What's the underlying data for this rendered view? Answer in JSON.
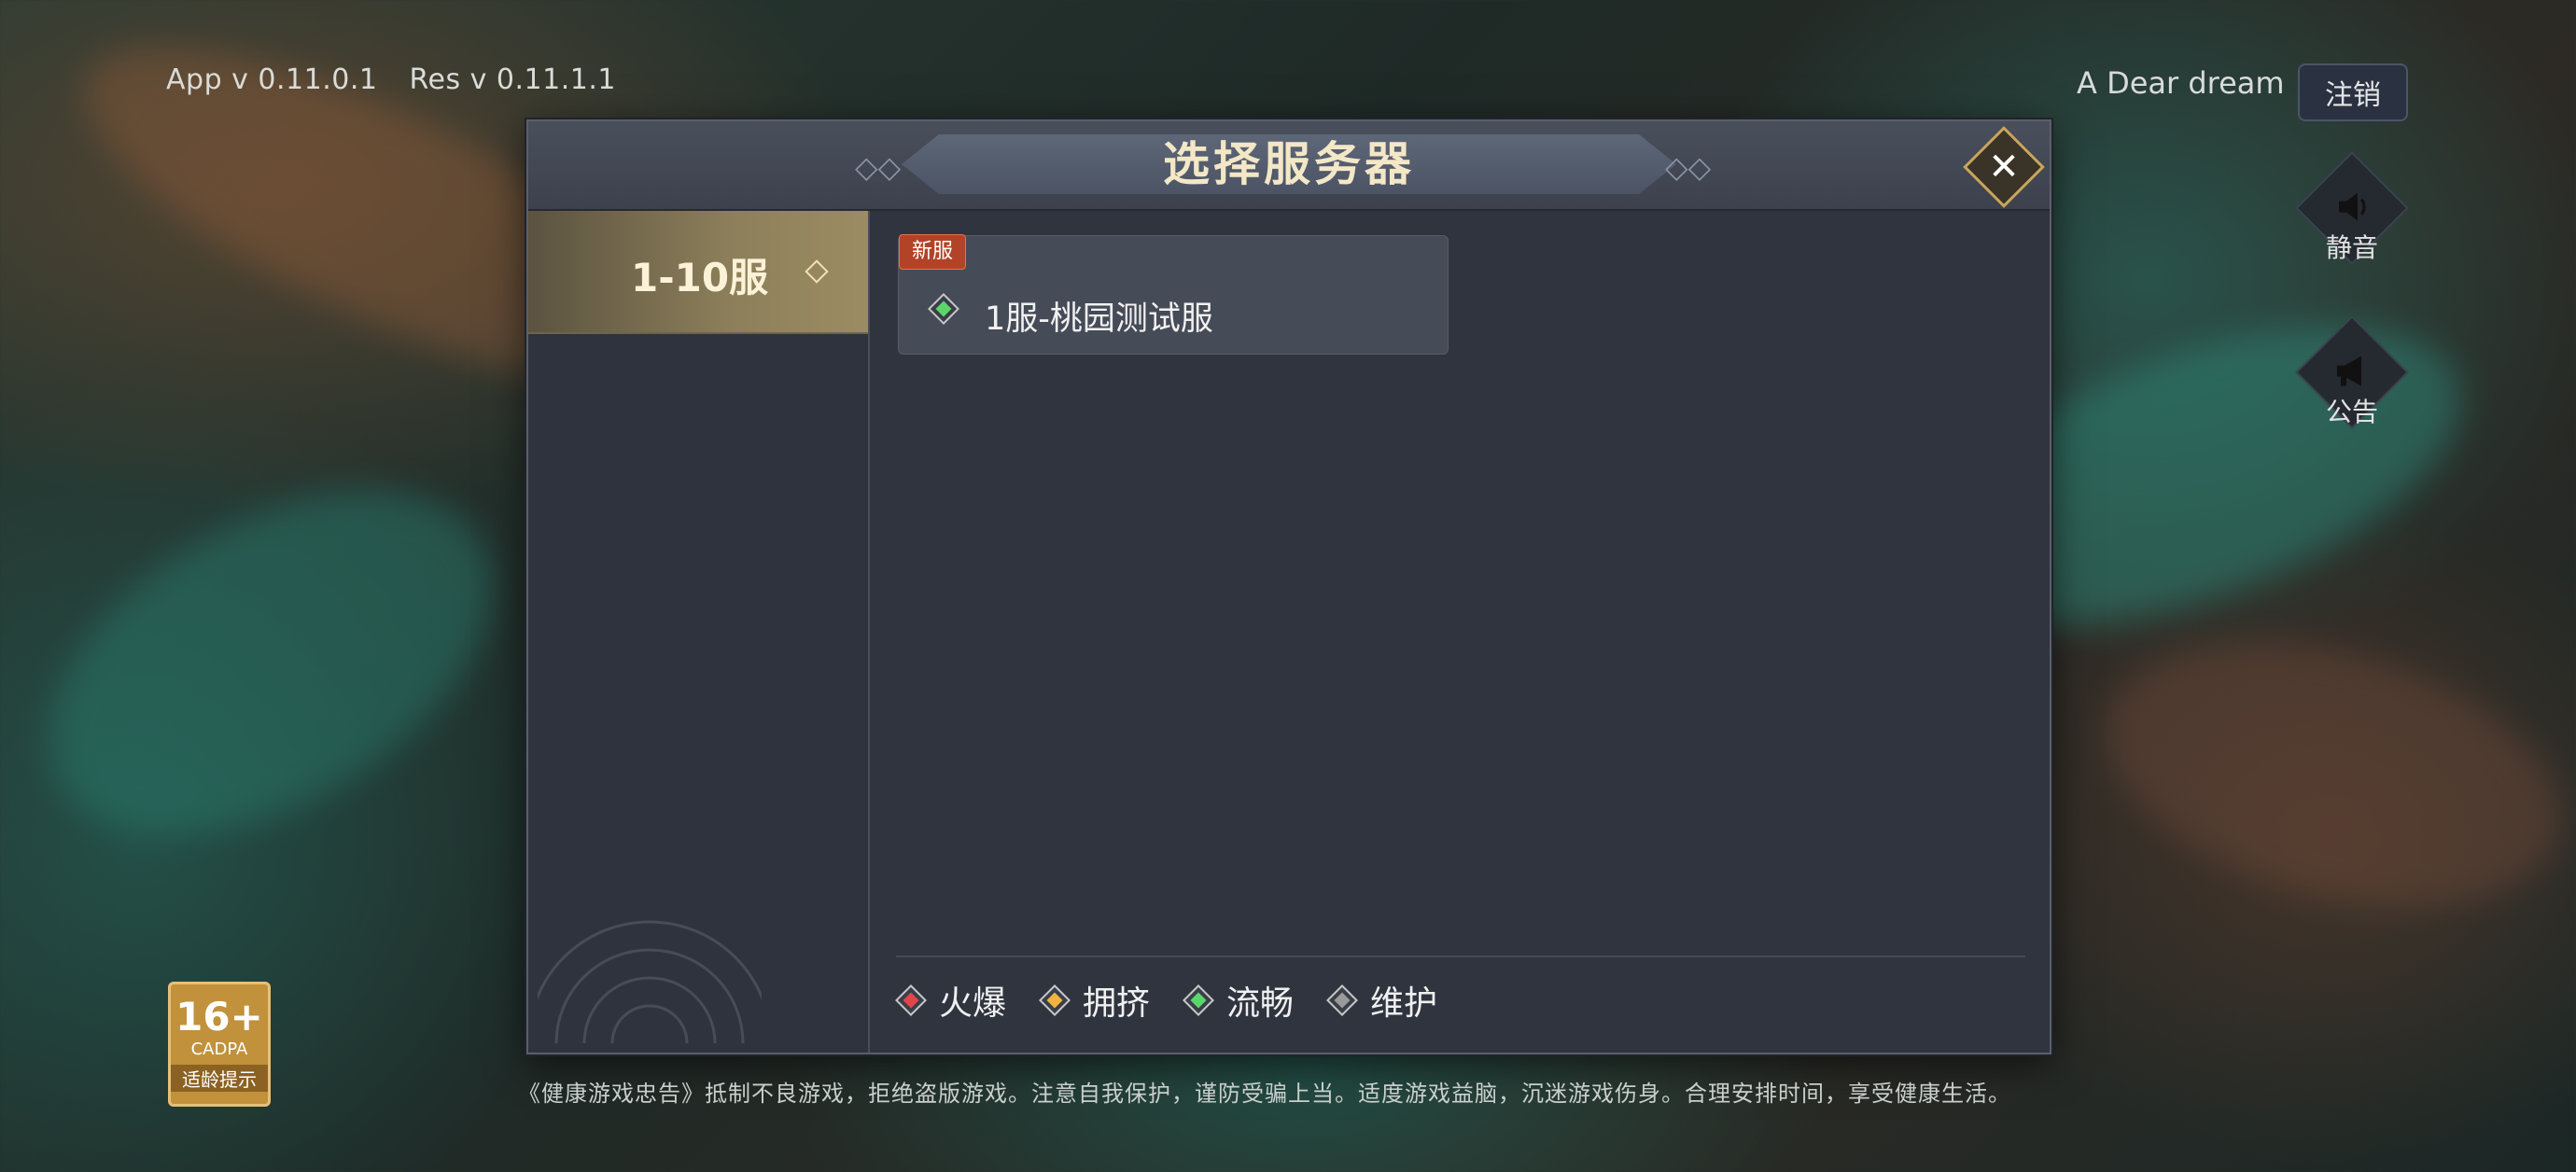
{
  "version": {
    "app": "App v 0.11.0.1",
    "res": "Res v 0.11.1.1"
  },
  "account": {
    "username": "A Dear dream",
    "logout_label": "注销"
  },
  "side_buttons": {
    "mute_label": "静音",
    "notice_label": "公告"
  },
  "dialog": {
    "title": "选择服务器",
    "range_tab": {
      "label": "1-10服"
    },
    "servers": [
      {
        "badge": "新服",
        "name": "1服-桃园测试服",
        "status": "流畅"
      }
    ],
    "legend": [
      {
        "label": "火爆",
        "color": "#e0454a"
      },
      {
        "label": "拥挤",
        "color": "#f1b43e"
      },
      {
        "label": "流畅",
        "color": "#5bd76a"
      },
      {
        "label": "维护",
        "color": "#9a9a9a"
      }
    ]
  },
  "age_rating": {
    "rating": "16+",
    "org": "CADPA",
    "tip": "适龄提示"
  },
  "footer": {
    "line2": "《健康游戏忠告》抵制不良游戏，拒绝盗版游戏。注意自我保护，谨防受骗上当。适度游戏益脑，沉迷游戏伤身。合理安排时间，享受健康生活。"
  }
}
